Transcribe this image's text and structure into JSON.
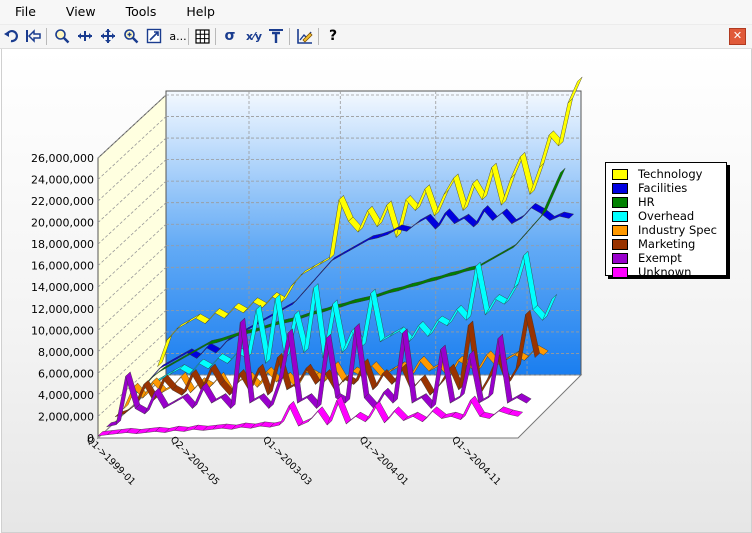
{
  "menu": [
    "File",
    "View",
    "Tools",
    "Help"
  ],
  "toolbar": {
    "icons": [
      "undo-icon",
      "back-icon",
      "zoom-icon",
      "move-horizontal-icon",
      "move-icon",
      "zoom-in-icon",
      "export-icon",
      "a...",
      "grid-icon",
      "sigma-icon",
      "xy-icon",
      "text-icon",
      "chart-edit-icon",
      "help-icon"
    ],
    "a_label": "a...",
    "sigma": "σ",
    "xy": "x⁄y",
    "help": "?",
    "close": "✕"
  },
  "chart_data": {
    "type": "line",
    "style": "3d-ribbon",
    "y_ticks": [
      "0",
      "2,000,000",
      "4,000,000",
      "6,000,000",
      "8,000,000",
      "10,000,000",
      "12,000,000",
      "14,000,000",
      "16,000,000",
      "18,000,000",
      "20,000,000",
      "22,000,000",
      "24,000,000",
      "26,000,000"
    ],
    "ylim": [
      0,
      26000000
    ],
    "x_labels": [
      "Q1->1999-01",
      "Q2->2002-05",
      "Q1->2003-03",
      "Q1->2004-01",
      "Q1->2004-11"
    ],
    "legend_position": "right",
    "series": [
      {
        "name": "Technology",
        "color": "#ffff00",
        "values": [
          1500000,
          4000000,
          5000000,
          5500000,
          6000000,
          5500000,
          6500000,
          6000000,
          7000000,
          6500000,
          7500000,
          7000000,
          8000000,
          7500000,
          9000000,
          10000000,
          10500000,
          11000000,
          11500000,
          17000000,
          15000000,
          14000000,
          16000000,
          14500000,
          16500000,
          13500000,
          17000000,
          16000000,
          18000000,
          15500000,
          17500000,
          19000000,
          16000000,
          18500000,
          17000000,
          20000000,
          16500000,
          19000000,
          21000000,
          17500000,
          20000000,
          23000000,
          22000000,
          26000000,
          28000000
        ]
      },
      {
        "name": "Facilities",
        "color": "#0000e0",
        "values": [
          1000000,
          2000000,
          2500000,
          3000000,
          3500000,
          3000000,
          4000000,
          3500000,
          4500000,
          5000000,
          5500000,
          6000000,
          6500000,
          7000000,
          7500000,
          8000000,
          9000000,
          10000000,
          11000000,
          12000000,
          12500000,
          13000000,
          13500000,
          14000000,
          14200000,
          14500000,
          15000000,
          14800000,
          15500000,
          16000000,
          15000000,
          16500000,
          15500000,
          16000000,
          15200000,
          16800000,
          15800000,
          16500000,
          15500000,
          16000000,
          17000000,
          16500000,
          15800000,
          16200000,
          16000000
        ]
      },
      {
        "name": "HR",
        "color": "#008000",
        "values": [
          800000,
          1800000,
          2500000,
          3000000,
          3500000,
          4000000,
          4500000,
          5000000,
          5200000,
          5500000,
          5800000,
          6000000,
          6200000,
          6500000,
          6800000,
          7000000,
          7200000,
          7500000,
          7800000,
          8000000,
          8300000,
          8500000,
          8800000,
          9000000,
          9200000,
          9500000,
          9800000,
          10000000,
          10300000,
          10500000,
          10800000,
          11000000,
          11300000,
          11500000,
          11800000,
          12000000,
          12500000,
          13000000,
          13500000,
          14000000,
          15000000,
          16000000,
          17000000,
          19000000,
          21000000
        ]
      },
      {
        "name": "Overhead",
        "color": "#00ffff",
        "values": [
          1000000,
          1500000,
          2000000,
          2500000,
          3000000,
          3500000,
          3000000,
          4000000,
          3500000,
          4500000,
          4000000,
          5000000,
          4500000,
          9000000,
          4000000,
          10000000,
          4500000,
          8500000,
          5000000,
          11000000,
          4500000,
          9500000,
          5000000,
          7000000,
          5500000,
          10500000,
          6000000,
          6500000,
          7000000,
          6000000,
          7500000,
          6500000,
          8000000,
          7500000,
          9000000,
          8000000,
          13000000,
          8500000,
          10000000,
          9500000,
          11000000,
          14000000,
          9000000,
          8000000,
          10000000
        ]
      },
      {
        "name": "Industry Spec",
        "color": "#ff9900",
        "values": [
          500000,
          2500000,
          1500000,
          3000000,
          2000000,
          2500000,
          3500000,
          2000000,
          3000000,
          2500000,
          3500000,
          2000000,
          3000000,
          3500000,
          2500000,
          4000000,
          3000000,
          3500000,
          2500000,
          4000000,
          3500000,
          3000000,
          4500000,
          3000000,
          4000000,
          3500000,
          4500000,
          3500000,
          4000000,
          4500000,
          3500000,
          5000000,
          4000000,
          4500000,
          3500000,
          5000000,
          4500000,
          4000000,
          5500000,
          4500000,
          5000000,
          5500000,
          5000000,
          6000000,
          5500000
        ]
      },
      {
        "name": "Marketing",
        "color": "#993300",
        "values": [
          500000,
          800000,
          1500000,
          3500000,
          2000000,
          4000000,
          3000000,
          2500000,
          4500000,
          3000000,
          5000000,
          3500000,
          2500000,
          4500000,
          3000000,
          5000000,
          2500000,
          6000000,
          3000000,
          3500000,
          5000000,
          3500000,
          4500000,
          3000000,
          4000000,
          3500000,
          5500000,
          3000000,
          4500000,
          3500000,
          5000000,
          3000000,
          4000000,
          2500000,
          3500000,
          5000000,
          3000000,
          9000000,
          2500000,
          4000000,
          6000000,
          3500000,
          5000000,
          10000000,
          6000000
        ]
      },
      {
        "name": "Exempt",
        "color": "#9900cc",
        "values": [
          300000,
          500000,
          5000000,
          2000000,
          1500000,
          3500000,
          2000000,
          2500000,
          3000000,
          2000000,
          4000000,
          2500000,
          3000000,
          2000000,
          10000000,
          2500000,
          3000000,
          2000000,
          4500000,
          9000000,
          2500000,
          3000000,
          2000000,
          8500000,
          3000000,
          2500000,
          9500000,
          3000000,
          2000000,
          3500000,
          2500000,
          9000000,
          2500000,
          3000000,
          2000000,
          7500000,
          2500000,
          3000000,
          7000000,
          2500000,
          3000000,
          8500000,
          2500000,
          3000000,
          2500000
        ]
      },
      {
        "name": "Unknown",
        "color": "#ff00ff",
        "values": [
          200000,
          300000,
          400000,
          500000,
          400000,
          500000,
          600000,
          500000,
          700000,
          600000,
          800000,
          700000,
          800000,
          900000,
          800000,
          1000000,
          900000,
          1100000,
          1000000,
          1200000,
          3000000,
          1100000,
          1500000,
          2500000,
          1200000,
          3500000,
          1300000,
          2000000,
          1500000,
          3000000,
          1400000,
          2500000,
          1600000,
          2000000,
          1500000,
          2500000,
          1800000,
          2000000,
          1700000,
          3500000,
          2000000,
          1800000,
          2500000,
          2200000,
          2000000
        ]
      }
    ]
  }
}
